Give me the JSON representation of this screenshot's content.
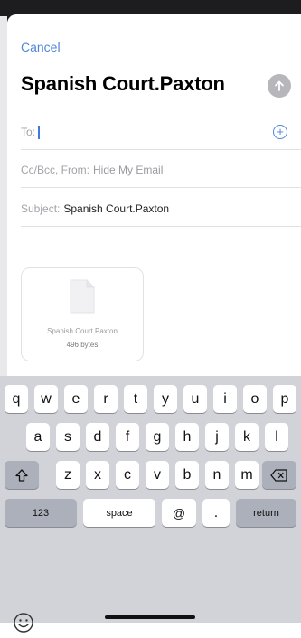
{
  "compose": {
    "cancel_label": "Cancel",
    "title": "Spanish Court.Paxton",
    "to_label": "To:",
    "cc_label": "Cc/Bcc, From:",
    "cc_value": "Hide My Email",
    "subject_label": "Subject:",
    "subject_value": "Spanish Court.Paxton"
  },
  "attachment": {
    "name": "Spanish Court.Paxton",
    "size": "496 bytes"
  },
  "keyboard": {
    "row1": [
      "q",
      "w",
      "e",
      "r",
      "t",
      "y",
      "u",
      "i",
      "o",
      "p"
    ],
    "row2": [
      "a",
      "s",
      "d",
      "f",
      "g",
      "h",
      "j",
      "k",
      "l"
    ],
    "row3": [
      "z",
      "x",
      "c",
      "v",
      "b",
      "n",
      "m"
    ],
    "numbers_label": "123",
    "space_label": "space",
    "at_label": "@",
    "dot_label": ".",
    "return_label": "return"
  },
  "colors": {
    "accent": "#4f86d9",
    "send_disabled": "#b6b6bb",
    "keyboard_bg": "#d1d3d9"
  },
  "icons": {
    "send": "arrow-up-circle-icon",
    "add_recipient": "plus-circle-icon",
    "shift": "shift-icon",
    "delete": "backspace-icon",
    "emoji": "emoji-icon",
    "attachment": "document-icon"
  }
}
